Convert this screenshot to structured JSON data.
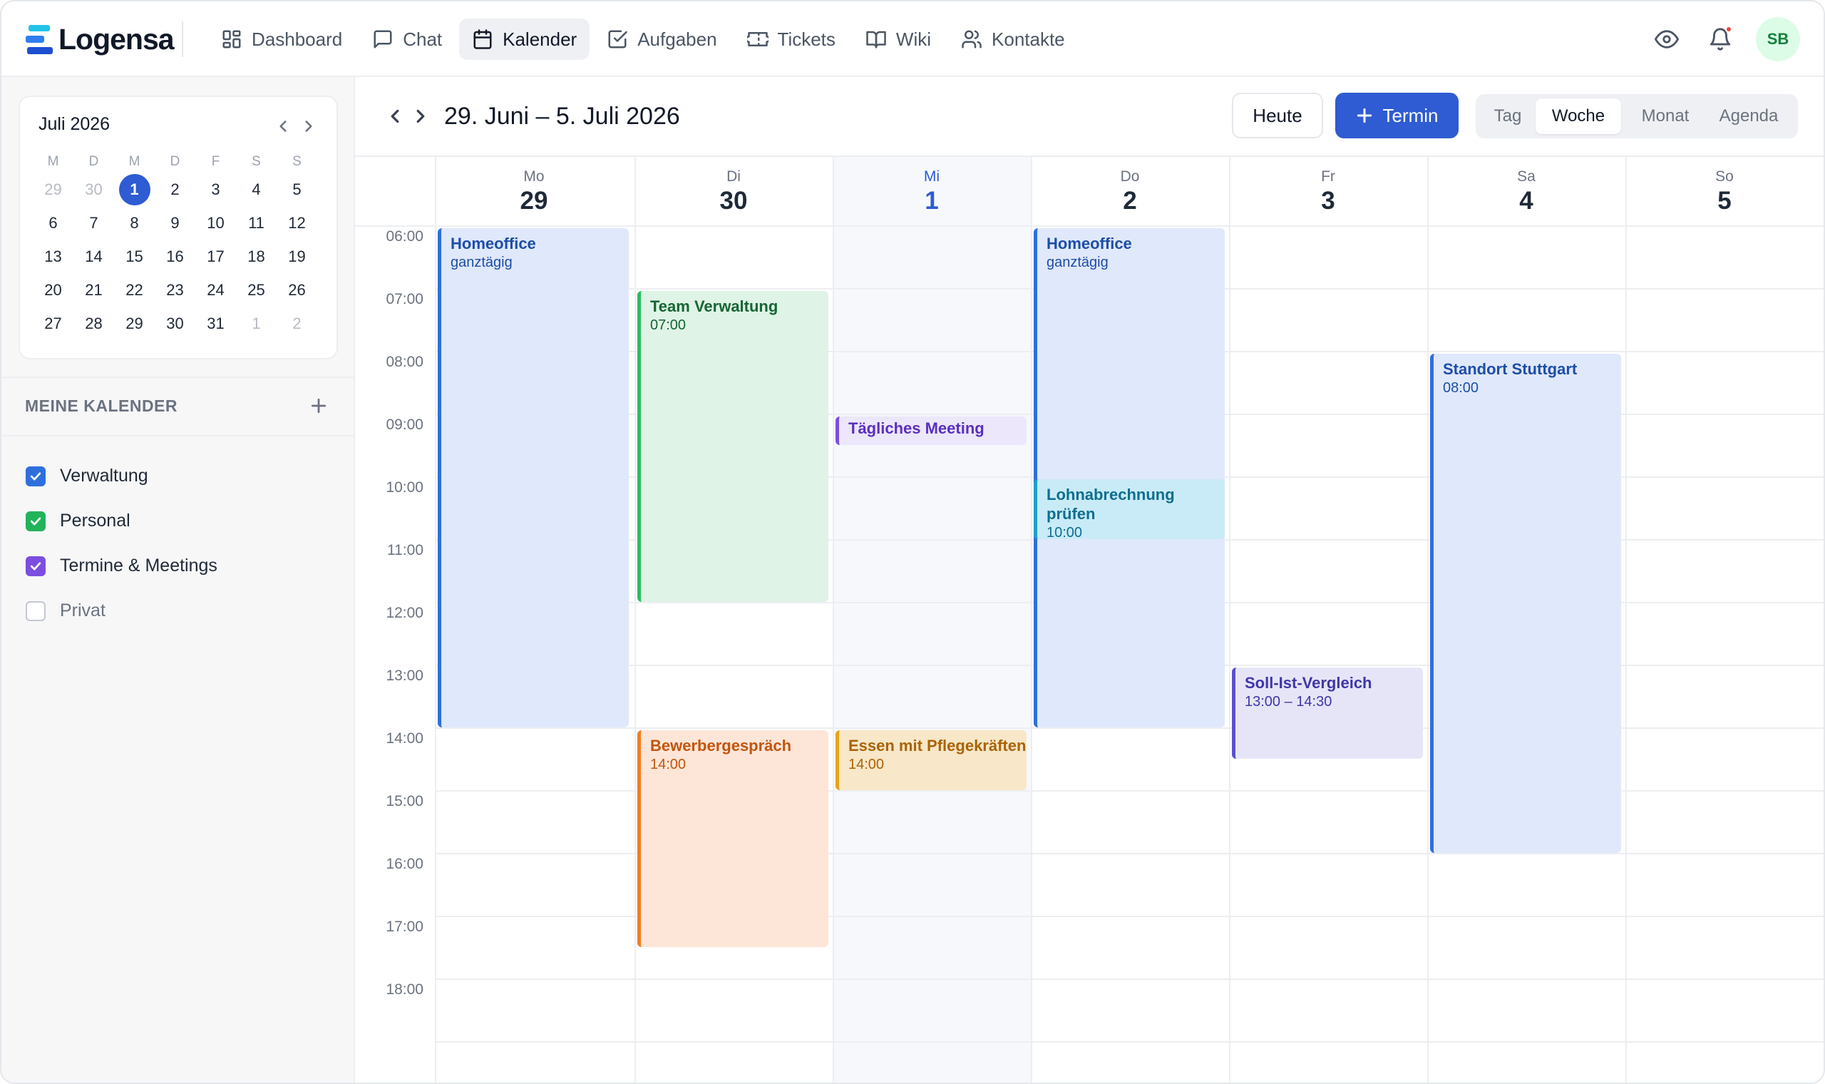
{
  "app": {
    "logo_text": "Logensa",
    "avatar_initials": "SB"
  },
  "nav": [
    {
      "label": "Dashboard",
      "icon": "dashboard-icon"
    },
    {
      "label": "Chat",
      "icon": "chat-icon"
    },
    {
      "label": "Kalender",
      "icon": "calendar-icon",
      "active": true
    },
    {
      "label": "Aufgaben",
      "icon": "task-check-icon"
    },
    {
      "label": "Tickets",
      "icon": "ticket-icon"
    },
    {
      "label": "Wiki",
      "icon": "book-icon"
    },
    {
      "label": "Kontakte",
      "icon": "contacts-icon"
    }
  ],
  "mini_calendar": {
    "title": "Juli 2026",
    "weekdays": [
      "M",
      "D",
      "M",
      "D",
      "F",
      "S",
      "S"
    ],
    "weeks": [
      [
        "29",
        "30",
        "1",
        "2",
        "3",
        "4",
        "5"
      ],
      [
        "6",
        "7",
        "8",
        "9",
        "10",
        "11",
        "12"
      ],
      [
        "13",
        "14",
        "15",
        "16",
        "17",
        "18",
        "19"
      ],
      [
        "20",
        "21",
        "22",
        "23",
        "24",
        "25",
        "26"
      ],
      [
        "27",
        "28",
        "29",
        "30",
        "31",
        "1",
        "2"
      ]
    ]
  },
  "my_calendars": {
    "heading": "MEINE KALENDER",
    "items": [
      {
        "label": "Verwaltung",
        "checked": true,
        "color": "#2f6fdc"
      },
      {
        "label": "Personal",
        "checked": true,
        "color": "#22b35a"
      },
      {
        "label": "Termine & Meetings",
        "checked": true,
        "color": "#7c4ee0"
      },
      {
        "label": "Privat",
        "checked": false,
        "color": "#c4c8cf"
      }
    ]
  },
  "header": {
    "range_title": "29. Juni – 5. Juli 2026",
    "today_label": "Heute",
    "new_label": "Termin",
    "views": [
      "Tag",
      "Woche",
      "Monat",
      "Agenda"
    ],
    "active_view": "Woche"
  },
  "week": {
    "days": [
      {
        "wd": "Mo",
        "num": "29"
      },
      {
        "wd": "Di",
        "num": "30"
      },
      {
        "wd": "Mi",
        "num": "1",
        "today": true
      },
      {
        "wd": "Do",
        "num": "2"
      },
      {
        "wd": "Fr",
        "num": "3"
      },
      {
        "wd": "Sa",
        "num": "4"
      },
      {
        "wd": "So",
        "num": "5"
      }
    ],
    "hours": [
      "06:00",
      "07:00",
      "08:00",
      "09:00",
      "10:00",
      "11:00",
      "12:00",
      "13:00",
      "14:00",
      "15:00",
      "16:00",
      "17:00",
      "18:00"
    ],
    "events": [
      {
        "day": 0,
        "start": 6,
        "end": 14,
        "title": "Homeoffice",
        "sub": "ganztägig",
        "color": "blue"
      },
      {
        "day": 1,
        "start": 7,
        "end": 12,
        "title": "Team Verwaltung",
        "sub": "07:00",
        "color": "green"
      },
      {
        "day": 1,
        "start": 14,
        "end": 17.5,
        "title": "Bewerbergespräch",
        "sub": "14:00",
        "color": "orange"
      },
      {
        "day": 2,
        "start": 9,
        "end": 9.5,
        "title": "Tägliches Meeting",
        "sub": "",
        "color": "purple"
      },
      {
        "day": 2,
        "start": 14,
        "end": 15,
        "title": "Essen mit Pflegekräften",
        "sub": "14:00",
        "color": "amber"
      },
      {
        "day": 3,
        "start": 6,
        "end": 14,
        "title": "Homeoffice",
        "sub": "ganztägig",
        "color": "blue"
      },
      {
        "day": 3,
        "start": 10,
        "end": 11,
        "title": "Lohnabrechnung prüfen",
        "sub": "10:00",
        "color": "cyan"
      },
      {
        "day": 4,
        "start": 13,
        "end": 14.5,
        "title": "Soll-Ist-Vergleich",
        "sub": "13:00 – 14:30",
        "color": "indigo"
      },
      {
        "day": 5,
        "start": 8,
        "end": 16,
        "title": "Standort Stuttgart",
        "sub": "08:00",
        "color": "blue"
      }
    ]
  }
}
